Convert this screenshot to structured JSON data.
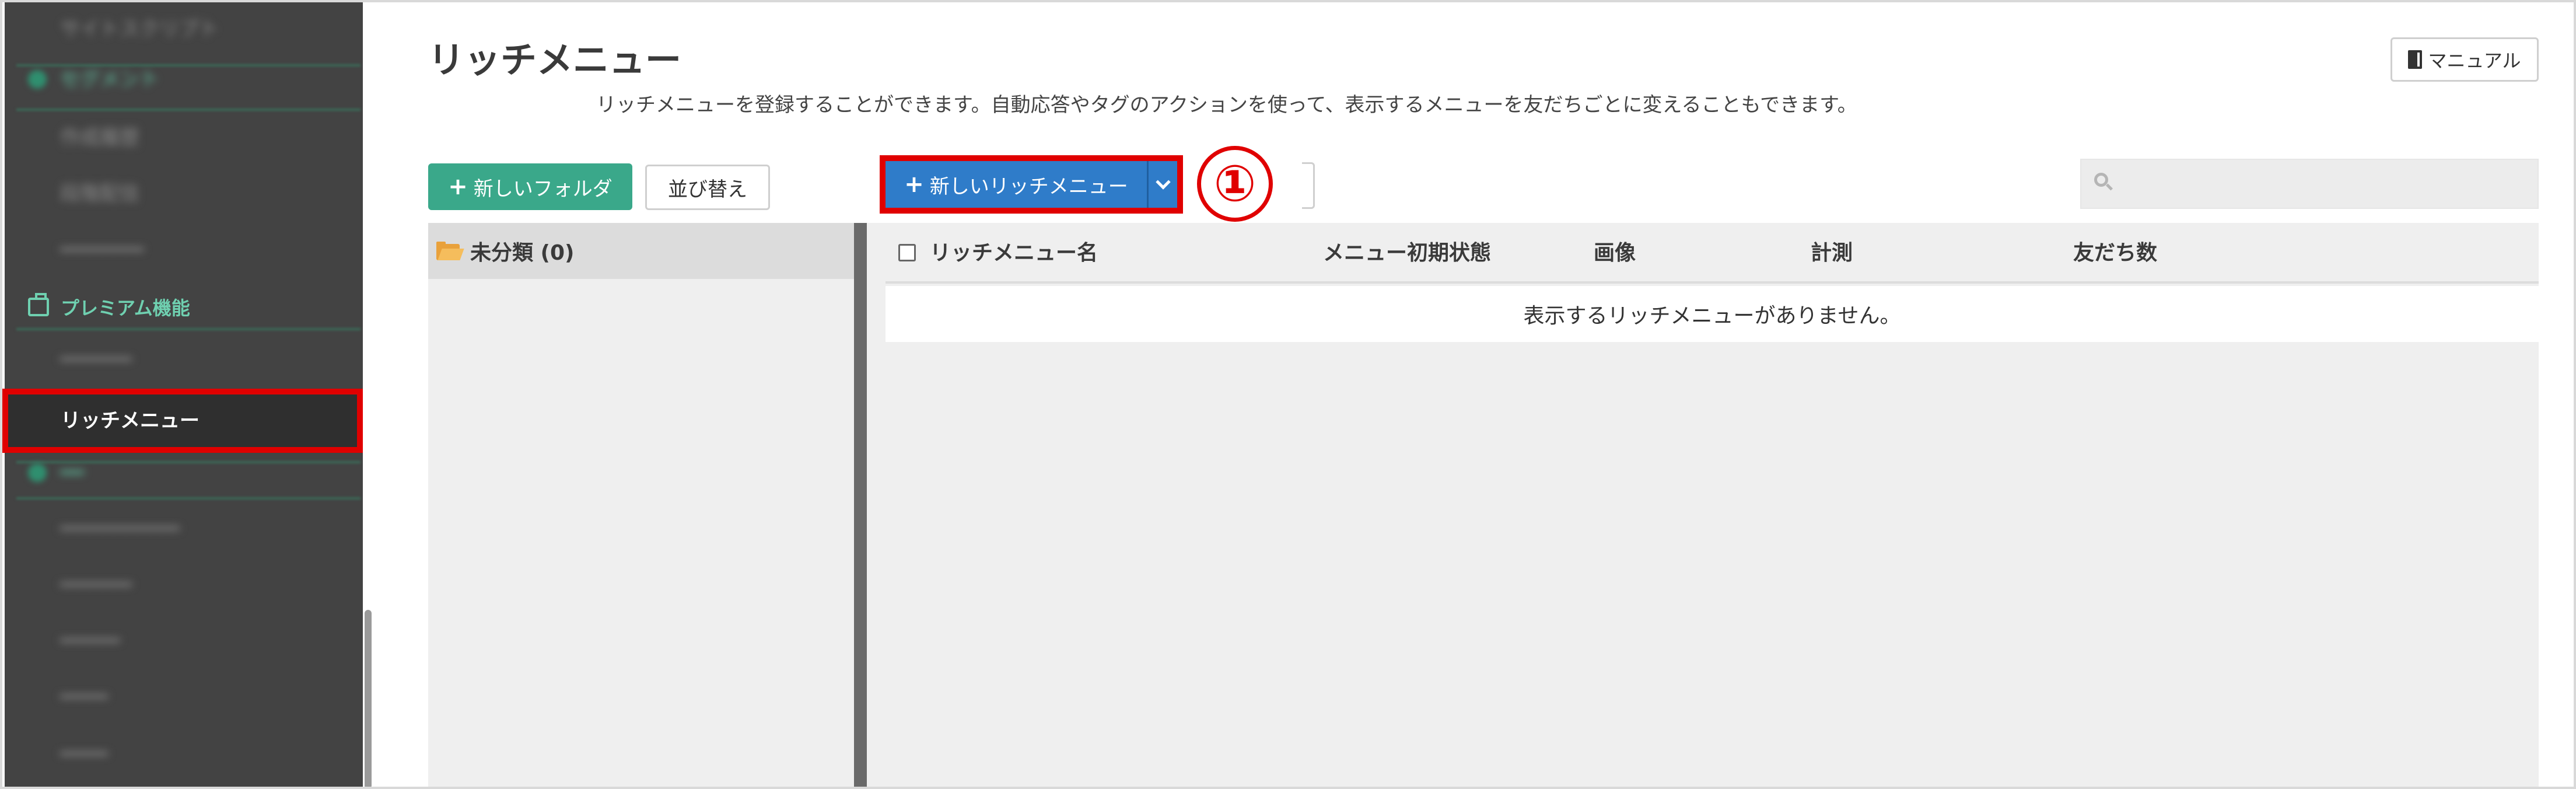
{
  "sidebar": {
    "blurred_items": [
      "サイトスクリプト",
      "セグメント",
      "作成履歴",
      "段階配信"
    ],
    "section_label": "プレミアム機能",
    "active_item": "リッチメニュー"
  },
  "header": {
    "title": "リッチメニュー",
    "description": "リッチメニューを登録することができます。自動応答やタグのアクションを使って、表示するメニューを友だちごとに変えることもできます。",
    "manual_label": "マニュアル"
  },
  "toolbar": {
    "new_folder_label": "新しいフォルダ",
    "sort_label": "並び替え",
    "new_rich_menu_label": "新しいリッチメニュー",
    "step_marker": "①",
    "search_placeholder": ""
  },
  "folders": [
    {
      "name": "未分類 (0)"
    }
  ],
  "table": {
    "columns": [
      "リッチメニュー名",
      "メニュー初期状態",
      "画像",
      "計測",
      "友だち数"
    ],
    "empty_message": "表示するリッチメニューがありません。"
  },
  "colors": {
    "sidebar_bg": "#434343",
    "accent_green": "#3aa88a",
    "primary_blue": "#2f7cc9",
    "highlight_red": "#e00000"
  }
}
